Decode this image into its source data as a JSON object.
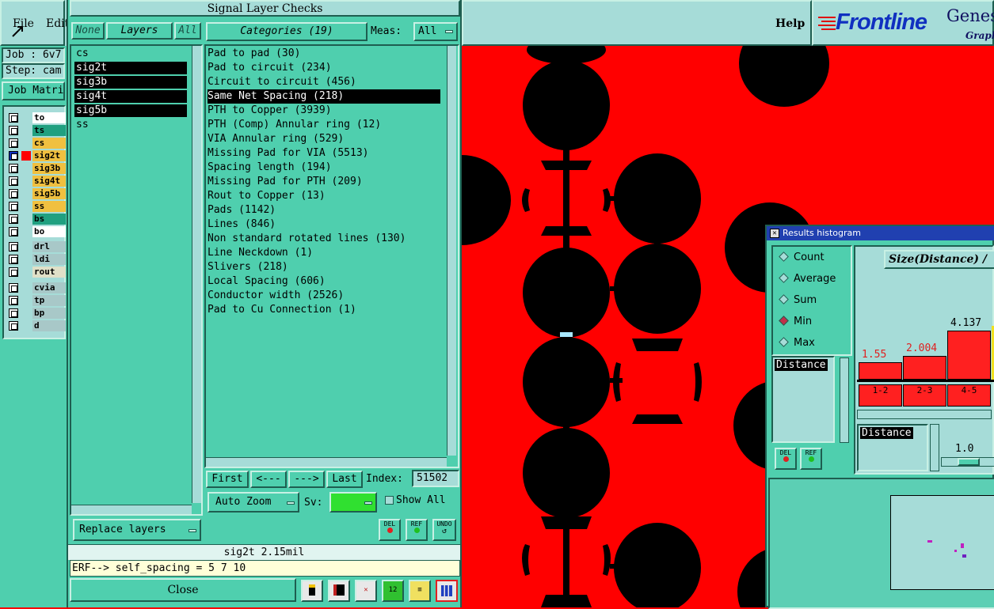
{
  "main_menu": {
    "file": "File",
    "edit": "Edit",
    "help": "Help"
  },
  "branding": {
    "logo": "Frontline",
    "product": "Genes",
    "subtitle": "Graph"
  },
  "left_panel": {
    "job_label": "Job : 6v7",
    "step_label": "Step: cam",
    "job_matrix_button": "Job Matri",
    "layers": [
      {
        "name": "to",
        "color": "#ffffff"
      },
      {
        "name": "ts",
        "color": "#20a080"
      },
      {
        "name": "cs",
        "color": "#f0c040"
      },
      {
        "name": "sig2t",
        "color": "#f0c040",
        "active": true
      },
      {
        "name": "sig3b",
        "color": "#f0c040"
      },
      {
        "name": "sig4t",
        "color": "#f0c040"
      },
      {
        "name": "sig5b",
        "color": "#f0c040"
      },
      {
        "name": "ss",
        "color": "#f0c040"
      },
      {
        "name": "bs",
        "color": "#20a080"
      },
      {
        "name": "bo",
        "color": "#ffffff"
      },
      {
        "name": "drl",
        "color": "#a8c8c8"
      },
      {
        "name": "ldi",
        "color": "#a8c8c8"
      },
      {
        "name": "rout",
        "color": "#e0e0c8"
      },
      {
        "name": "cvia",
        "color": "#a8c8c8"
      },
      {
        "name": "tp",
        "color": "#a8c8c8"
      },
      {
        "name": "bp",
        "color": "#a8c8c8"
      },
      {
        "name": "d",
        "color": "#a8c8c8"
      }
    ]
  },
  "signal_dialog": {
    "title": "Signal Layer Checks",
    "none_button": "None",
    "layers_header": "Layers",
    "all_button": "All",
    "layers": [
      {
        "name": "cs",
        "selected": false
      },
      {
        "name": "sig2t",
        "selected": true
      },
      {
        "name": "sig3b",
        "selected": true
      },
      {
        "name": "sig4t",
        "selected": true
      },
      {
        "name": "sig5b",
        "selected": true
      },
      {
        "name": "ss",
        "selected": false
      }
    ],
    "categories_header": "Categories (19)",
    "meas_label": "Meas:",
    "meas_value": "All",
    "categories": [
      "Pad to pad (30)",
      "Pad to circuit (234)",
      "Circuit to circuit (456)",
      "Same Net Spacing (218)",
      "PTH to Copper (3939)",
      "PTH (Comp) Annular ring (12)",
      "VIA Annular ring (529)",
      "Missing Pad for VIA (5513)",
      "Spacing length (194)",
      "Missing Pad for PTH (209)",
      "Rout to Copper (13)",
      "Pads (1142)",
      "Lines (846)",
      "Non standard rotated lines (130)",
      "Line Neckdown (1)",
      "Slivers (218)",
      "Local Spacing (606)",
      "Conductor width (2526)",
      "Pad to Cu Connection (1)"
    ],
    "selected_category": 3,
    "nav": {
      "first": "First",
      "prev": "<---",
      "next": "--->",
      "last": "Last"
    },
    "index_label": "Index:",
    "index_value": "51502",
    "auto_zoom": "Auto Zoom",
    "sv_label": "Sv:",
    "show_all": "Show All",
    "replace_layers": "Replace layers",
    "del": "DEL",
    "ref": "REF",
    "undo": "UNDO",
    "status": "sig2t 2.15mil",
    "erf_line": "ERF--> self_spacing = 5 7 10",
    "close": "Close"
  },
  "histogram": {
    "title": "Results histogram",
    "modes": [
      "Count",
      "Average",
      "Sum",
      "Min",
      "Max"
    ],
    "selected_mode": "Min",
    "field_header": "Size(Distance) /",
    "list_item": "Distance",
    "del": "DEL",
    "ref": "REF",
    "bars": [
      {
        "value": "1.55",
        "range": "1-2"
      },
      {
        "value": "2.004",
        "range": "2-3"
      },
      {
        "value": "4.137",
        "range": "4-5"
      }
    ],
    "distance_label": "Distance",
    "slider_value": "1.0"
  },
  "colors": {
    "canvas_bg": "#ff0000",
    "panel": "#4fcfae",
    "light_panel": "#a6dcd8",
    "accent": "#c0304a"
  }
}
